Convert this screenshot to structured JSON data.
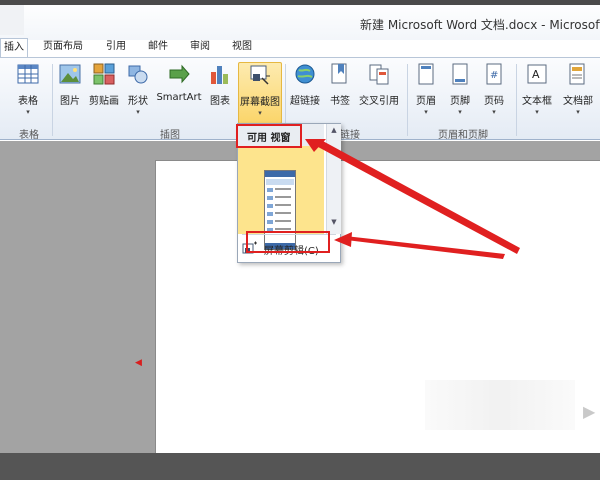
{
  "window": {
    "title": "新建 Microsoft Word 文档.docx  -  Microsoft W"
  },
  "tabs": [
    {
      "label": "插入",
      "active": true
    },
    {
      "label": "页面布局"
    },
    {
      "label": "引用"
    },
    {
      "label": "邮件"
    },
    {
      "label": "审阅"
    },
    {
      "label": "视图"
    }
  ],
  "ribbon": {
    "table": {
      "label": "表格"
    },
    "picture": {
      "label": "图片"
    },
    "clipart": {
      "label": "剪贴画"
    },
    "shapes": {
      "label": "形状"
    },
    "smartart": {
      "label": "SmartArt"
    },
    "chart": {
      "label": "图表"
    },
    "screenshot": {
      "label": "屏幕截图"
    },
    "hyperlink": {
      "label": "超链接"
    },
    "bookmark": {
      "label": "书签"
    },
    "crossref": {
      "label": "交叉引用"
    },
    "header": {
      "label": "页眉"
    },
    "footer": {
      "label": "页脚"
    },
    "pagenum": {
      "label": "页码"
    },
    "textbox": {
      "label": "文本框"
    },
    "docparts": {
      "label": "文档部"
    }
  },
  "groups": {
    "tables": "表格",
    "illustrations": "插图",
    "links": "链接",
    "header_footer": "页眉和页脚"
  },
  "dropdown": {
    "header": "可用 视窗",
    "clipping_label": "屏幕剪辑(C)"
  },
  "colors": {
    "accent_red": "#e02020",
    "highlight": "#fbd56a",
    "workspace": "#a3a3a3"
  }
}
